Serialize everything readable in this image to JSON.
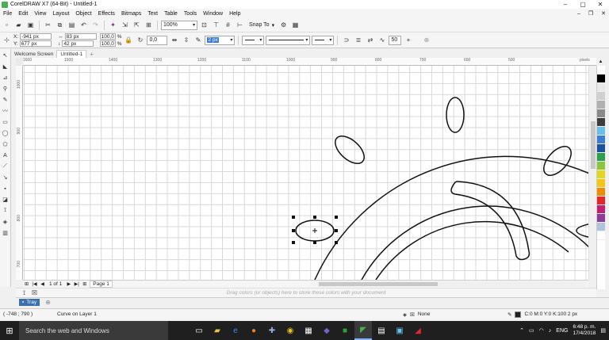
{
  "window": {
    "title": "CorelDRAW X7 (64-Bit) - Untitled-1"
  },
  "menu": [
    "File",
    "Edit",
    "View",
    "Layout",
    "Object",
    "Effects",
    "Bitmaps",
    "Text",
    "Table",
    "Tools",
    "Window",
    "Help"
  ],
  "toolbar": {
    "zoom": "100%",
    "snap_label": "Snap To"
  },
  "property_bar": {
    "x": "-941 px",
    "y": "677 px",
    "width": "83 px",
    "height": "42 px",
    "scale_x": "100,0",
    "scale_y": "100,0",
    "percent": "%",
    "rotation": "0,0",
    "outline_width": "2 px",
    "smoothing": "50"
  },
  "doc_tabs": [
    "Welcome Screen",
    "Untitled-1"
  ],
  "ruler": {
    "top_labels": [
      "1600",
      "1500",
      "1400",
      "1300",
      "1200",
      "1100",
      "1000",
      "900",
      "800",
      "700",
      "600",
      "500"
    ],
    "unit": "pixels",
    "left_labels": [
      "1000",
      "900",
      "800",
      "700"
    ]
  },
  "page_nav": {
    "page_count": "1 of 1",
    "page_tab": "Page 1"
  },
  "colorbar_hint": "Drag colors (or objects) here to store these colors with your document",
  "tray": {
    "label": "Tray"
  },
  "status": {
    "coords": "( -748 ; 790 )",
    "info": "Curve on Layer 1",
    "fill": "None",
    "outline": "C:0 M:0 Y:0 K:100  2 px"
  },
  "taskbar": {
    "search_placeholder": "Search the web and Windows",
    "lang": "ENG",
    "time": "6:48 p. m.",
    "date": "17/4/2018"
  },
  "palette": [
    "#ffffff",
    "#000000",
    "#e8e8e8",
    "#d0d0d0",
    "#b0b0b0",
    "#8a8a8a",
    "#3d3d3d",
    "#6ac0e8",
    "#3b7dd8",
    "#1e4fa0",
    "#2aa04a",
    "#8cc63f",
    "#e2d81b",
    "#f5c518",
    "#f08a00",
    "#e3262d",
    "#c51f70",
    "#8e3a98",
    "#b0c4de",
    "#ffffff"
  ]
}
